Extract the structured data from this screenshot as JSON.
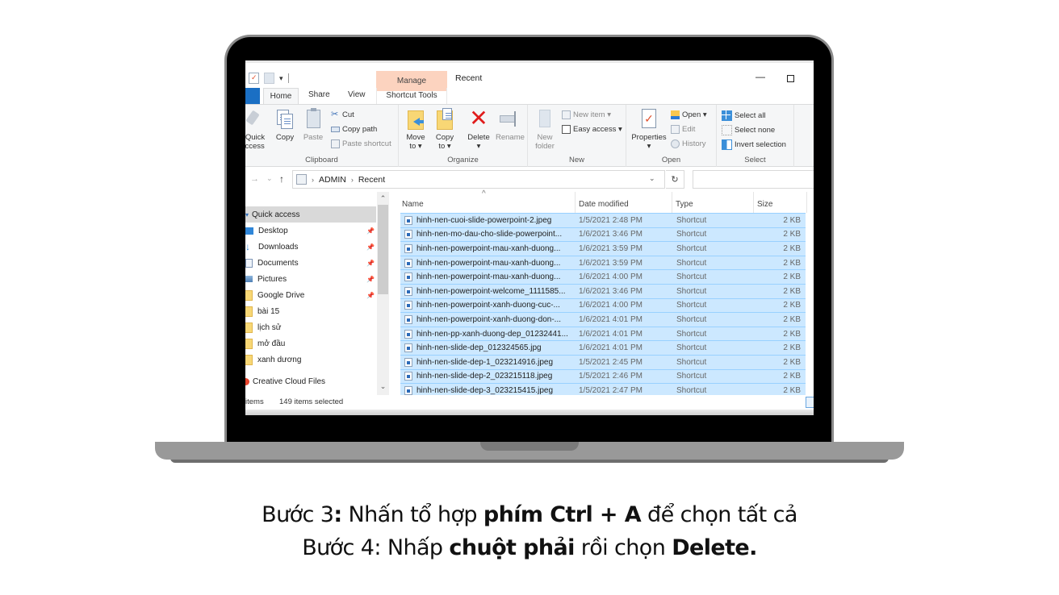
{
  "window": {
    "title": "Recent",
    "contextual_tab_group": "Manage",
    "controls": {
      "minimize": "—",
      "maximize": "□"
    }
  },
  "ribbon_tabs": [
    {
      "label": "Home",
      "active": true
    },
    {
      "label": "Share"
    },
    {
      "label": "View"
    },
    {
      "label": "Shortcut Tools"
    }
  ],
  "ribbon": {
    "clipboard": {
      "label": "Clipboard",
      "pin_quick_access": [
        "Quick",
        "access"
      ],
      "copy": "Copy",
      "paste": "Paste",
      "cut": "Cut",
      "copy_path": "Copy path",
      "paste_shortcut": "Paste shortcut"
    },
    "organize": {
      "label": "Organize",
      "move_to": [
        "Move",
        "to ▾"
      ],
      "copy_to": [
        "Copy",
        "to ▾"
      ],
      "delete": [
        "Delete",
        "▾"
      ],
      "rename": "Rename"
    },
    "new": {
      "label": "New",
      "new_folder": [
        "New",
        "folder"
      ],
      "new_item": "New item ▾",
      "easy_access": "Easy access ▾"
    },
    "open": {
      "label": "Open",
      "properties": [
        "Properties",
        "▾"
      ],
      "open": "Open ▾",
      "edit": "Edit",
      "history": "History"
    },
    "select": {
      "label": "Select",
      "select_all": "Select all",
      "select_none": "Select none",
      "invert_selection": "Invert selection"
    }
  },
  "address_bar": {
    "back": "←",
    "forward": "→",
    "recent_dropdown": "⌄",
    "up": "↑",
    "breadcrumb": [
      "ADMIN",
      "Recent"
    ],
    "separator": "›",
    "dropdown": "⌄",
    "refresh": "↻",
    "search_placeholder": ""
  },
  "nav_pane": {
    "items": [
      {
        "label": "Quick access",
        "type": "header",
        "selected": true
      },
      {
        "label": "Desktop",
        "icon": "desktop-icon",
        "pinned": true
      },
      {
        "label": "Downloads",
        "icon": "download-icon",
        "pinned": true
      },
      {
        "label": "Documents",
        "icon": "documents-icon",
        "pinned": true
      },
      {
        "label": "Pictures",
        "icon": "pictures-icon",
        "pinned": true
      },
      {
        "label": "Google Drive",
        "icon": "folder-icon",
        "pinned": true
      },
      {
        "label": "bài 15",
        "icon": "folder-icon"
      },
      {
        "label": "lịch sử",
        "icon": "folder-icon"
      },
      {
        "label": "mở đầu",
        "icon": "folder-icon"
      },
      {
        "label": "xanh dương",
        "icon": "folder-icon"
      },
      {
        "label": "Creative Cloud Files",
        "icon": "creative-cloud-icon"
      }
    ]
  },
  "file_list": {
    "columns": [
      "Name",
      "Date modified",
      "Type",
      "Size"
    ],
    "rows": [
      {
        "name": "hinh-nen-cuoi-slide-powerpoint-2.jpeg",
        "date": "1/5/2021 2:48 PM",
        "type": "Shortcut",
        "size": "2 KB"
      },
      {
        "name": "hinh-nen-mo-dau-cho-slide-powerpoint...",
        "date": "1/6/2021 3:46 PM",
        "type": "Shortcut",
        "size": "2 KB"
      },
      {
        "name": "hinh-nen-powerpoint-mau-xanh-duong...",
        "date": "1/6/2021 3:59 PM",
        "type": "Shortcut",
        "size": "2 KB"
      },
      {
        "name": "hinh-nen-powerpoint-mau-xanh-duong...",
        "date": "1/6/2021 3:59 PM",
        "type": "Shortcut",
        "size": "2 KB"
      },
      {
        "name": "hinh-nen-powerpoint-mau-xanh-duong...",
        "date": "1/6/2021 4:00 PM",
        "type": "Shortcut",
        "size": "2 KB"
      },
      {
        "name": "hinh-nen-powerpoint-welcome_1111585...",
        "date": "1/6/2021 3:46 PM",
        "type": "Shortcut",
        "size": "2 KB"
      },
      {
        "name": "hinh-nen-powerpoint-xanh-duong-cuc-...",
        "date": "1/6/2021 4:00 PM",
        "type": "Shortcut",
        "size": "2 KB"
      },
      {
        "name": "hinh-nen-powerpoint-xanh-duong-don-...",
        "date": "1/6/2021 4:01 PM",
        "type": "Shortcut",
        "size": "2 KB"
      },
      {
        "name": "hinh-nen-pp-xanh-duong-dep_01232441...",
        "date": "1/6/2021 4:01 PM",
        "type": "Shortcut",
        "size": "2 KB"
      },
      {
        "name": "hinh-nen-slide-dep_012324565.jpg",
        "date": "1/6/2021 4:01 PM",
        "type": "Shortcut",
        "size": "2 KB"
      },
      {
        "name": "hinh-nen-slide-dep-1_023214916.jpeg",
        "date": "1/5/2021 2:45 PM",
        "type": "Shortcut",
        "size": "2 KB"
      },
      {
        "name": "hinh-nen-slide-dep-2_023215118.jpeg",
        "date": "1/5/2021 2:46 PM",
        "type": "Shortcut",
        "size": "2 KB"
      },
      {
        "name": "hinh-nen-slide-dep-3_023215415.jpeg",
        "date": "1/5/2021 2:47 PM",
        "type": "Shortcut",
        "size": "2 KB"
      }
    ]
  },
  "status_bar": {
    "item_count": "items",
    "selected": "149 items selected"
  },
  "caption": {
    "line1": [
      {
        "text": "Bước 3",
        "bold": false
      },
      {
        "text": ":",
        "bold": true
      },
      {
        "text": " Nhấn tổ hợp ",
        "bold": false
      },
      {
        "text": "phím Ctrl + A",
        "bold": true
      },
      {
        "text": " để chọn tất cả",
        "bold": false
      }
    ],
    "line2": [
      {
        "text": "Bước 4: Nhấp ",
        "bold": false
      },
      {
        "text": "chuột phải",
        "bold": true
      },
      {
        "text": " rồi chọn ",
        "bold": false
      },
      {
        "text": "Delete.",
        "bold": true
      }
    ]
  }
}
